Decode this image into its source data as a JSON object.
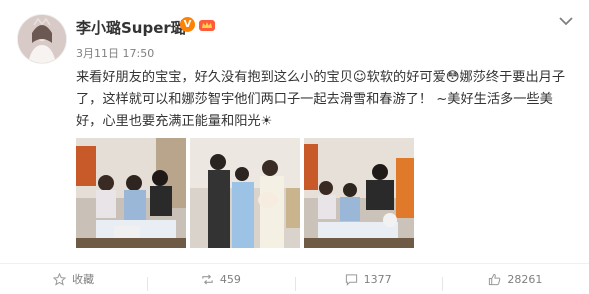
{
  "post": {
    "username": "李小璐Super璐",
    "verified_badge": "V",
    "timestamp": "3月11日 17:50",
    "content": "来看好朋友的宝宝，好久没有抱到这么小的宝贝☺软软的好可爱😳娜莎终于要出月子了，这样就可以和娜莎智宇他们两口子一起去滑雪和春游了！ ~美好生活多一些美好，心里也要充满正能量和阳光☀"
  },
  "footer": {
    "favorite_label": "收藏",
    "repost_count": "459",
    "comment_count": "1377",
    "like_count": "28261"
  },
  "icons": {
    "more": "chevron-down-icon",
    "favorite": "star-icon",
    "repost": "repost-icon",
    "comment": "comment-icon",
    "like": "thumbs-up-icon"
  },
  "colors": {
    "verified": "#ff8200",
    "meta_text": "#808080",
    "text": "#333333"
  }
}
